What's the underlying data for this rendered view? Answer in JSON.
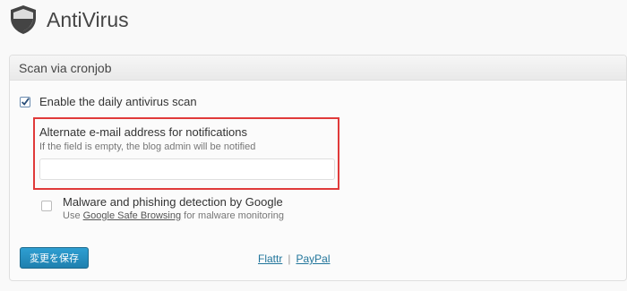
{
  "app": {
    "title": "AntiVirus",
    "logo_icon": "shield-icon"
  },
  "panel": {
    "title": "Scan via cronjob",
    "enable_scan": {
      "label": "Enable the daily antivirus scan",
      "checked": true
    },
    "email": {
      "label": "Alternate e-mail address for notifications",
      "hint": "If the field is empty, the blog admin will be notified",
      "value": "",
      "highlight_color": "#e03a3a"
    },
    "malware": {
      "label": "Malware and phishing detection by Google",
      "desc_prefix": "Use ",
      "desc_link": "Google Safe Browsing",
      "desc_suffix": " for malware monitoring",
      "checked": false
    },
    "save_button": "変更を保存",
    "links": {
      "flattr": "Flattr",
      "separator": "|",
      "paypal": "PayPal"
    }
  }
}
